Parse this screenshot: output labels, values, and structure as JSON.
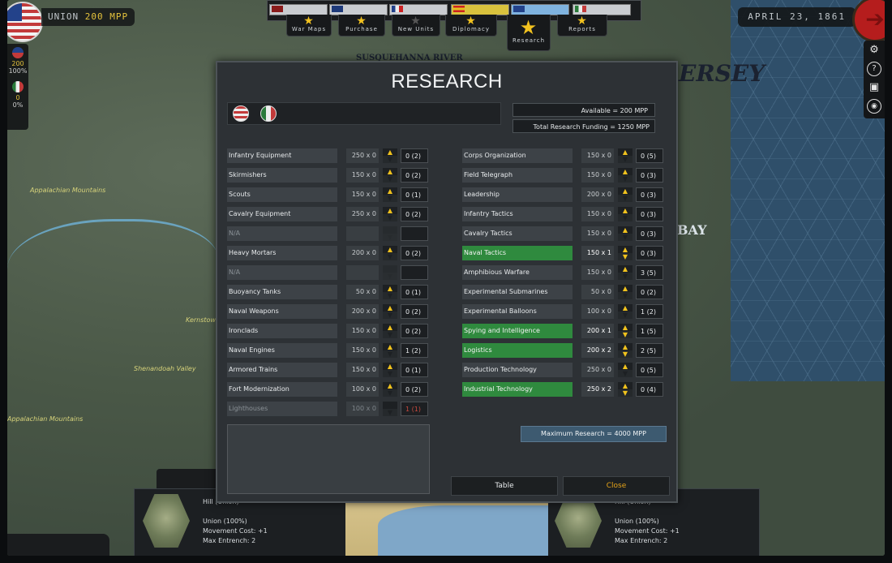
{
  "header": {
    "faction_label": "UNION",
    "mpp_value": "200 MPP",
    "date": "APRIL 23, 1861",
    "side_stats": [
      {
        "value": "200",
        "pct": "100%"
      },
      {
        "value": "0",
        "pct": "0%"
      }
    ]
  },
  "tabs": [
    {
      "label": "War Maps"
    },
    {
      "label": "Purchase"
    },
    {
      "label": "New Units"
    },
    {
      "label": "Diplomacy"
    },
    {
      "label": "Research"
    },
    {
      "label": "Reports"
    }
  ],
  "map_labels": {
    "river": "SUSQUEHANNA RIVER",
    "jersey": "ERSEY",
    "bay": "BAY",
    "appalachian1": "Appalachian Mountains",
    "appalachian2": "Appalachian Mountains",
    "shenandoah": "Shenandoah Valley",
    "kernstown": "Kernstown"
  },
  "right_icons": [
    "gear-icon",
    "help-icon",
    "save-icon",
    "settings-icon"
  ],
  "dialog": {
    "title": "RESEARCH",
    "available": "Available =  200 MPP",
    "funding": "Total Research Funding =  1250 MPP",
    "max_research": "Maximum Research =   4000 MPP",
    "table_button": "Table",
    "close_button": "Close"
  },
  "research_left": [
    {
      "name": "Infantry Equipment",
      "cost": "250 x 0",
      "level": "0 (2)",
      "green": false,
      "disabled": false,
      "red": false
    },
    {
      "name": "Skirmishers",
      "cost": "150 x 0",
      "level": "0 (2)",
      "green": false,
      "disabled": false,
      "red": false
    },
    {
      "name": "Scouts",
      "cost": "150 x 0",
      "level": "0 (1)",
      "green": false,
      "disabled": false,
      "red": false
    },
    {
      "name": "Cavalry Equipment",
      "cost": "250 x 0",
      "level": "0 (2)",
      "green": false,
      "disabled": false,
      "red": false
    },
    {
      "name": "N/A",
      "cost": "",
      "level": "",
      "green": false,
      "disabled": true,
      "red": false
    },
    {
      "name": "Heavy Mortars",
      "cost": "200 x 0",
      "level": "0 (2)",
      "green": false,
      "disabled": false,
      "red": false
    },
    {
      "name": "N/A",
      "cost": "",
      "level": "",
      "green": false,
      "disabled": true,
      "red": false
    },
    {
      "name": "Buoyancy Tanks",
      "cost": "50 x 0",
      "level": "0 (1)",
      "green": false,
      "disabled": false,
      "red": false
    },
    {
      "name": "Naval Weapons",
      "cost": "200 x 0",
      "level": "0 (2)",
      "green": false,
      "disabled": false,
      "red": false
    },
    {
      "name": "Ironclads",
      "cost": "150 x 0",
      "level": "0 (2)",
      "green": false,
      "disabled": false,
      "red": false
    },
    {
      "name": "Naval Engines",
      "cost": "150 x 0",
      "level": "1 (2)",
      "green": false,
      "disabled": false,
      "red": false
    },
    {
      "name": "Armored Trains",
      "cost": "150 x 0",
      "level": "0 (1)",
      "green": false,
      "disabled": false,
      "red": false
    },
    {
      "name": "Fort Modernization",
      "cost": "100 x 0",
      "level": "0 (2)",
      "green": false,
      "disabled": false,
      "red": false
    },
    {
      "name": "Lighthouses",
      "cost": "100 x 0",
      "level": "1 (1)",
      "green": false,
      "disabled": true,
      "red": true
    }
  ],
  "research_right": [
    {
      "name": "Corps Organization",
      "cost": "150 x 0",
      "level": "0 (5)",
      "green": false
    },
    {
      "name": "Field Telegraph",
      "cost": "150 x 0",
      "level": "0 (3)",
      "green": false
    },
    {
      "name": "Leadership",
      "cost": "200 x 0",
      "level": "0 (3)",
      "green": false
    },
    {
      "name": "Infantry Tactics",
      "cost": "150 x 0",
      "level": "0 (3)",
      "green": false
    },
    {
      "name": "Cavalry Tactics",
      "cost": "150 x 0",
      "level": "0 (3)",
      "green": false
    },
    {
      "name": "Naval Tactics",
      "cost": "150 x 1",
      "level": "0 (3)",
      "green": true
    },
    {
      "name": "Amphibious Warfare",
      "cost": "150 x 0",
      "level": "3 (5)",
      "green": false
    },
    {
      "name": "Experimental Submarines",
      "cost": "50 x 0",
      "level": "0 (2)",
      "green": false
    },
    {
      "name": "Experimental Balloons",
      "cost": "100 x 0",
      "level": "1 (2)",
      "green": false
    },
    {
      "name": "Spying and Intelligence",
      "cost": "200 x 1",
      "level": "1 (5)",
      "green": true
    },
    {
      "name": "Logistics",
      "cost": "200 x 2",
      "level": "2 (5)",
      "green": true
    },
    {
      "name": "Production Technology",
      "cost": "250 x 0",
      "level": "0 (5)",
      "green": false
    },
    {
      "name": "Industrial Technology",
      "cost": "250 x 2",
      "level": "0 (4)",
      "green": true
    }
  ],
  "bottom": {
    "left": {
      "title": "Hill (Union)",
      "line1": "Union (100%)",
      "line2": "Movement Cost: +1",
      "line3": "Max Entrench: 2"
    },
    "right": {
      "title": "Hill (Union)",
      "line1": "Union (100%)",
      "line2": "Movement Cost: +1",
      "line3": "Max Entrench: 2"
    }
  },
  "colors": {
    "accent": "#f0c21d",
    "green": "#2f8a3e",
    "close": "#e5a318",
    "union_blue": "#23428a"
  }
}
